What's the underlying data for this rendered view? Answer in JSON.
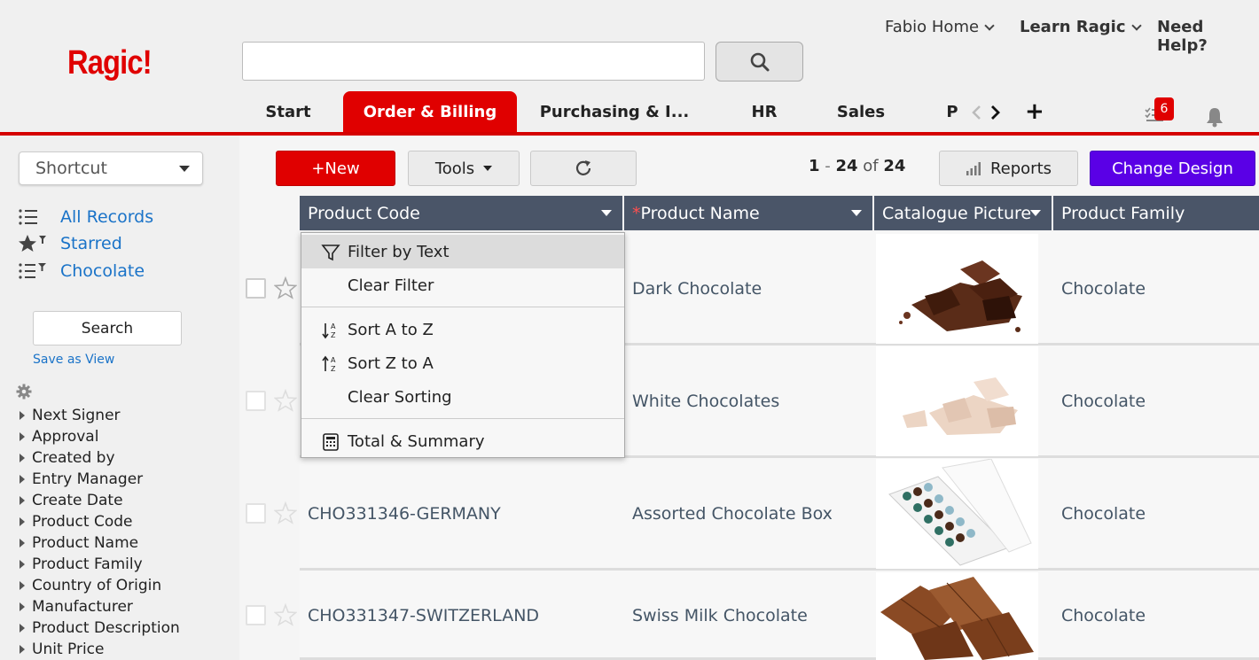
{
  "app": {
    "logo": "Ragic!",
    "top_links": {
      "account": "Fabio Home",
      "learn": "Learn Ragic",
      "help": "Need Help?"
    },
    "tabs": [
      "Start",
      "Order & Billing",
      "Purchasing & I...",
      "HR",
      "Sales",
      "P"
    ],
    "active_tab": "Order & Billing",
    "plus_label": "+",
    "notification_count": "6",
    "accent_color": "#e00000"
  },
  "sidebar": {
    "shortcut_label": "Shortcut",
    "views": [
      "All Records",
      "Starred",
      "Chocolate"
    ],
    "search_label": "Search",
    "save_view_label": "Save as View",
    "fields": [
      "Next Signer",
      "Approval",
      "Created by",
      "Entry Manager",
      "Create Date",
      "Product Code",
      "Product Name",
      "Product Family",
      "Country of Origin",
      "Manufacturer",
      "Product Description",
      "Unit Price"
    ]
  },
  "toolbar": {
    "new_label": "+New",
    "tools_label": "Tools",
    "pager": {
      "start": "1",
      "end": "24",
      "of_label": "of",
      "total": "24",
      "dash": "-"
    },
    "reports_label": "Reports",
    "change_design_label": "Change Design",
    "design_color": "#5a00e6"
  },
  "grid": {
    "columns": [
      {
        "label": "Product Code",
        "required": false
      },
      {
        "label": "Product Name",
        "required": true
      },
      {
        "label": "Catalogue Picture",
        "required": false
      },
      {
        "label": "Product Family",
        "required": false
      }
    ],
    "required_marker": "*",
    "rows": [
      {
        "code": "",
        "name": "Dark Chocolate",
        "picture": "dark-chocolate-pieces",
        "family": "Chocolate"
      },
      {
        "code": "",
        "name": "White Chocolates",
        "picture": "white-chocolate-pieces",
        "family": "Chocolate"
      },
      {
        "code": "CHO331346-GERMANY",
        "name": "Assorted Chocolate Box",
        "picture": "chocolate-box",
        "family": "Chocolate"
      },
      {
        "code": "CHO331347-SWITZERLAND",
        "name": "Swiss Milk Chocolate",
        "picture": "milk-chocolate-bar",
        "family": "Chocolate"
      }
    ]
  },
  "column_menu": {
    "items": [
      {
        "label": "Filter by Text",
        "icon": "filter-icon"
      },
      {
        "label": "Clear Filter",
        "icon": ""
      },
      {
        "label": "Sort A to Z",
        "icon": "sort-ascending-icon"
      },
      {
        "label": "Sort Z to A",
        "icon": "sort-descending-icon"
      },
      {
        "label": "Clear Sorting",
        "icon": ""
      },
      {
        "label": "Total & Summary",
        "icon": "calculator-icon"
      }
    ]
  }
}
